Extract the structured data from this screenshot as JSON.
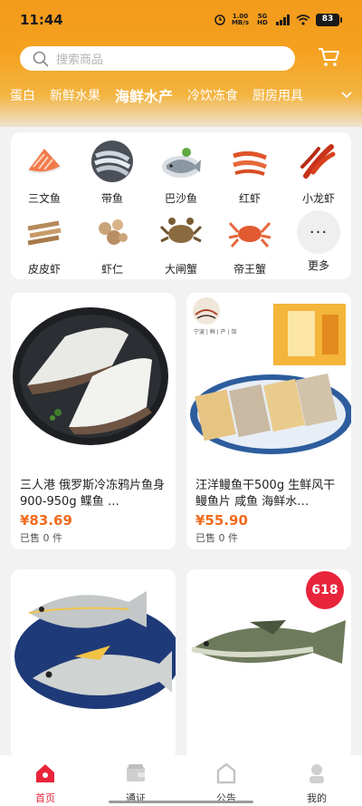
{
  "status": {
    "time": "11:44",
    "net_speed": "1.00",
    "net_unit": "MB/s",
    "network": "5G HD",
    "battery": "83"
  },
  "search": {
    "placeholder": "搜索商品"
  },
  "categories": {
    "tabs": [
      "蛋白",
      "新鲜水果",
      "海鲜水产",
      "冷饮冻食",
      "厨房用具"
    ],
    "active_index": 2
  },
  "grid": {
    "items": [
      {
        "label": "三文鱼",
        "icon": "salmon-icon"
      },
      {
        "label": "带鱼",
        "icon": "hairtail-icon"
      },
      {
        "label": "巴沙鱼",
        "icon": "basa-fish-icon"
      },
      {
        "label": "红虾",
        "icon": "red-shrimp-icon"
      },
      {
        "label": "小龙虾",
        "icon": "crayfish-icon"
      },
      {
        "label": "皮皮虾",
        "icon": "mantis-shrimp-icon"
      },
      {
        "label": "虾仁",
        "icon": "shrimp-meat-icon"
      },
      {
        "label": "大闸蟹",
        "icon": "hairy-crab-icon"
      },
      {
        "label": "帝王蟹",
        "icon": "king-crab-icon"
      },
      {
        "label": "更多",
        "icon": "more-icon"
      }
    ],
    "more_glyph": "···"
  },
  "products": [
    {
      "title": "三人港 俄罗斯冷冻鸦片鱼身900-950g 鲽鱼 …",
      "price": "¥83.69",
      "sold": "已售 0 件"
    },
    {
      "title": "汪洋鳗鱼干500g 生鲜风干鳗鱼片 咸鱼 海鲜水…",
      "price": "¥55.90",
      "sold": "已售 0 件",
      "brand_text": "宁波 | 鲜 | 产 | 馆"
    },
    {
      "title": "",
      "price": "",
      "sold": ""
    },
    {
      "title": "",
      "price": "",
      "sold": "",
      "badge": "618"
    }
  ],
  "nav": {
    "items": [
      {
        "label": "首页",
        "active": true
      },
      {
        "label": "通证",
        "active": false
      },
      {
        "label": "公告",
        "active": false
      },
      {
        "label": "我的",
        "active": false
      }
    ]
  },
  "colors": {
    "accent": "#e8243b",
    "price": "#f26b1d",
    "header": "#f39a1c"
  }
}
